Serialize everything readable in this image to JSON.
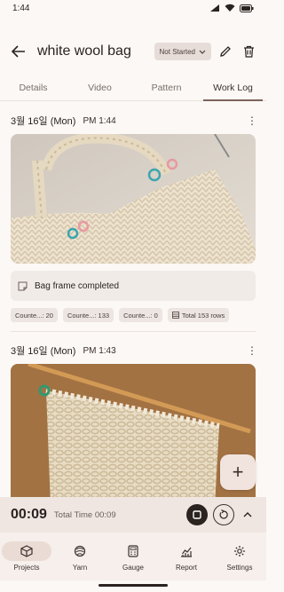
{
  "status_bar": {
    "time": "1:44"
  },
  "header": {
    "title": "white wool bag",
    "status": "Not Started"
  },
  "tabs": [
    {
      "label": "Details",
      "active": false
    },
    {
      "label": "Video",
      "active": false
    },
    {
      "label": "Pattern",
      "active": false
    },
    {
      "label": "Work Log",
      "active": true
    }
  ],
  "entries": [
    {
      "date": "3월 16일 (Mon)",
      "time": "PM 1:44",
      "note": "Bag frame completed",
      "counters": [
        "Counte...: 20",
        "Counte...: 133",
        "Counte...: 0"
      ],
      "total": "Total 153 rows"
    },
    {
      "date": "3월 16일 (Mon)",
      "time": "PM 1:43"
    }
  ],
  "fab": {
    "label": "+"
  },
  "timer": {
    "elapsed": "00:09",
    "total": "Total Time 00:09"
  },
  "nav": [
    {
      "label": "Projects",
      "icon": "box-icon",
      "active": true
    },
    {
      "label": "Yarn",
      "icon": "yarn-icon",
      "active": false
    },
    {
      "label": "Gauge",
      "icon": "calculator-icon",
      "active": false
    },
    {
      "label": "Report",
      "icon": "chart-icon",
      "active": false
    },
    {
      "label": "Settings",
      "icon": "gear-icon",
      "active": false
    }
  ],
  "colors": {
    "background": "#fbf8f5",
    "accent": "#7c625b",
    "nav_active": "#eadbd5",
    "timer_bar": "#efe6e2"
  }
}
